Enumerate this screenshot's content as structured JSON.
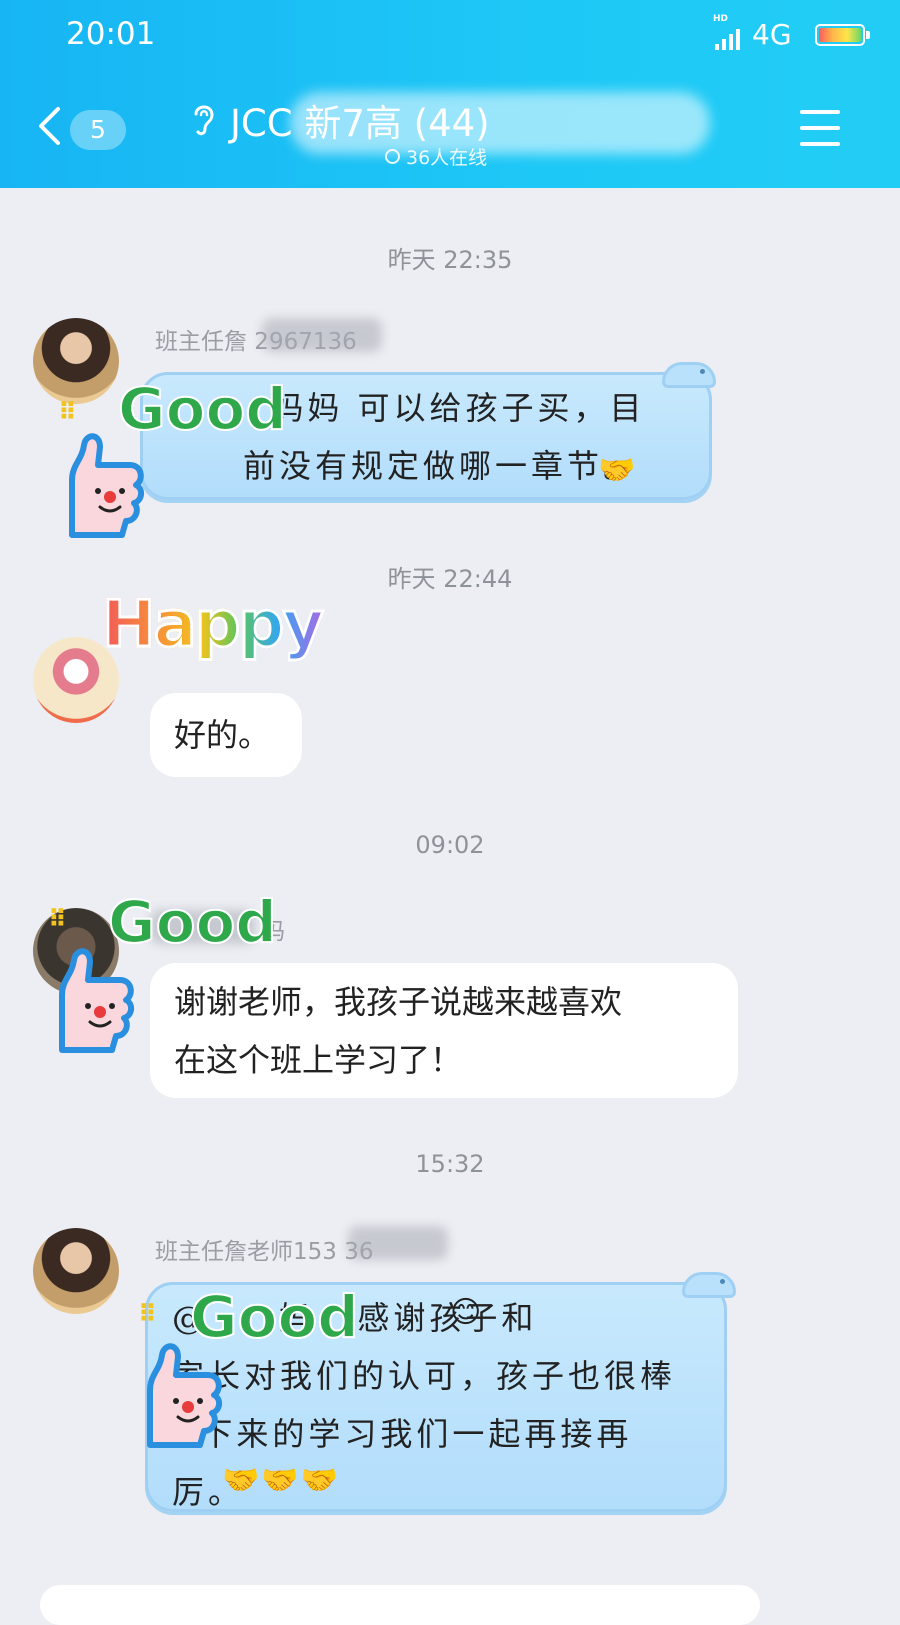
{
  "status_bar": {
    "time": "20:01",
    "hd": "HD",
    "network": "4G",
    "network_suffix": "ıl"
  },
  "header": {
    "unread_count": "5",
    "group_title": "JCC 新7高 (44)",
    "online_text": "36人在线"
  },
  "messages": [
    {
      "timestamp": "昨天 22:35",
      "sender": "班主任詹 2967136",
      "text": "  妈妈 可以给孩子买，目\n前没有规定做哪一章节。",
      "sticker": "Good"
    },
    {
      "timestamp": "昨天 22:44",
      "sender": "",
      "text": "好的。",
      "sticker": "Happy"
    },
    {
      "timestamp": "09:02",
      "sender": "妈",
      "text": "谢谢老师，我孩子说越来越喜欢\n在这个班上学习了！",
      "sticker": "Good"
    },
    {
      "timestamp": "15:32",
      "sender": "班主任詹老师153 36",
      "text": "@     妈   感谢孩子和\n家长对我们的认可，孩子也很棒\n  下来的学习我们一起再接再\n厉。",
      "sticker": "Good"
    }
  ],
  "colors": {
    "header": "#17b5f4",
    "background": "#eceef3",
    "bubble_blue": "#c2e5fc"
  }
}
